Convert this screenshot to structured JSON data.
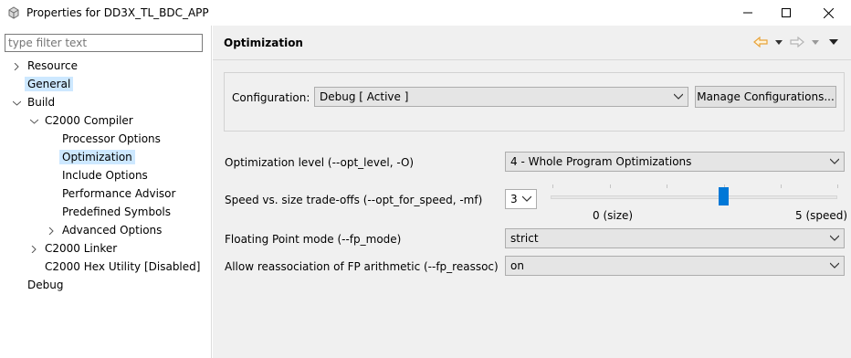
{
  "window": {
    "title": "Properties for DD3X_TL_BDC_APP",
    "icon": "gear-box-icon"
  },
  "filter": {
    "placeholder": "type filter text",
    "value": ""
  },
  "tree": {
    "resource": "Resource",
    "general": "General",
    "build": "Build",
    "c2000_compiler": "C2000 Compiler",
    "processor_options": "Processor Options",
    "optimization": "Optimization",
    "include_options": "Include Options",
    "performance_advisor": "Performance Advisor",
    "predefined_symbols": "Predefined Symbols",
    "advanced_options": "Advanced Options",
    "c2000_linker": "C2000 Linker",
    "c2000_hex_utility": "C2000 Hex Utility  [Disabled]",
    "debug": "Debug",
    "selected": "Optimization"
  },
  "page": {
    "title": "Optimization"
  },
  "configuration": {
    "label": "Configuration:",
    "value": "Debug  [ Active ]",
    "manage_button": "Manage Configurations..."
  },
  "settings": {
    "opt_level_label": "Optimization level (--opt_level, -O)",
    "opt_level_value": "4 - Whole Program Optimizations",
    "speed_label": "Speed vs. size trade-offs (--opt_for_speed, -mf)",
    "speed_value": "3",
    "speed_min_label": "0 (size)",
    "speed_max_label": "5 (speed)",
    "speed_level": 3,
    "speed_max": 5,
    "fp_mode_label": "Floating Point mode (--fp_mode)",
    "fp_mode_value": "strict",
    "fp_reassoc_label": "Allow reassociation of FP arithmetic (--fp_reassoc)",
    "fp_reassoc_value": "on"
  },
  "colors": {
    "selection": "#cde8ff",
    "accent": "#0078d7",
    "nav_arrow": "#e8a33a"
  }
}
